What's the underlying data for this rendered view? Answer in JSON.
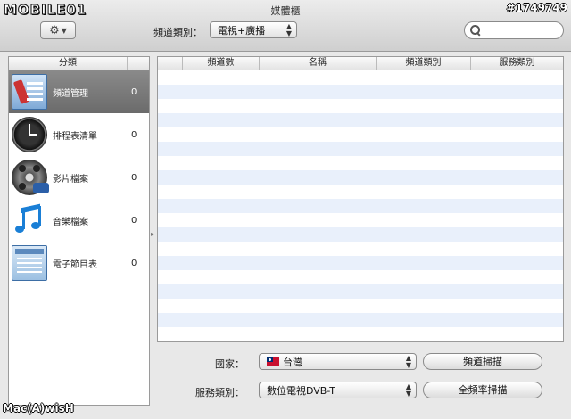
{
  "window": {
    "title": "媒體櫃",
    "logo_text": "MOBILE01",
    "watermark_id": "#1749749",
    "bottom_logo": "Mac(A)wisH"
  },
  "toolbar": {
    "channel_type_label": "頻道類別：",
    "channel_type_value": "電視+廣播",
    "search_placeholder": ""
  },
  "sidebar": {
    "header": "分類",
    "items": [
      {
        "label": "頻道管理",
        "count": "0",
        "icon": "channel-manager-icon",
        "selected": true
      },
      {
        "label": "排程表清單",
        "count": "0",
        "icon": "schedule-clock-icon",
        "selected": false
      },
      {
        "label": "影片檔案",
        "count": "0",
        "icon": "film-reel-icon",
        "selected": false
      },
      {
        "label": "音樂檔案",
        "count": "0",
        "icon": "music-note-icon",
        "selected": false
      },
      {
        "label": "電子節目表",
        "count": "0",
        "icon": "program-guide-icon",
        "selected": false
      }
    ]
  },
  "table": {
    "columns": [
      "",
      "頻道數",
      "名稱",
      "頻道類別",
      "服務類別"
    ],
    "rows": []
  },
  "bottom": {
    "country_label": "國家：",
    "country_value": "台灣",
    "service_label": "服務類別：",
    "service_value": "數位電視DVB-T",
    "scan_button": "頻道掃描",
    "full_scan_button": "全頻率掃描"
  }
}
